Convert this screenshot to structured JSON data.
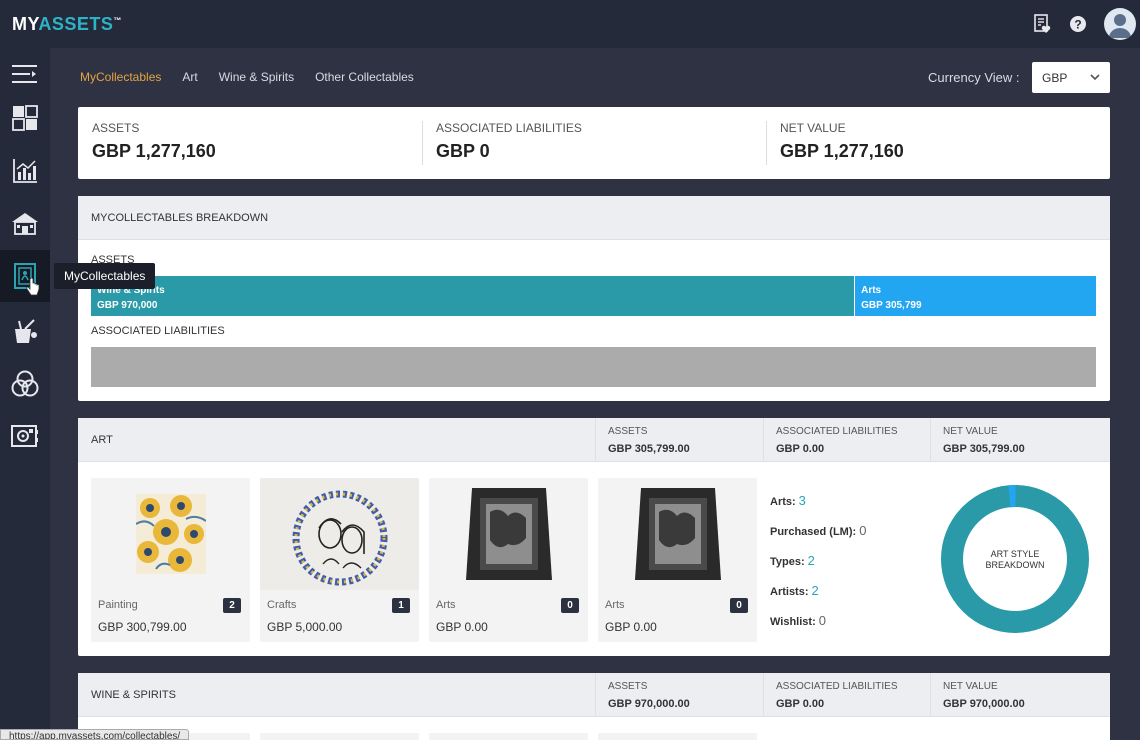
{
  "app": {
    "logo_prefix": "MY",
    "logo_main": "ASSETS",
    "logo_tm": "™"
  },
  "topbar": {
    "icons": [
      "document-heart-icon",
      "help-icon",
      "user-avatar-icon"
    ]
  },
  "sidebar": {
    "items": [
      "menu-collapse-icon",
      "dashboard-icon",
      "chart-icon",
      "property-icon",
      "collectables-icon",
      "art-supplies-icon",
      "venn-icon",
      "safe-icon"
    ],
    "active": "collectables-icon",
    "tooltip": "MyCollectables"
  },
  "subnav": {
    "tabs": [
      {
        "label": "MyCollectables",
        "active": true
      },
      {
        "label": "Art",
        "active": false
      },
      {
        "label": "Wine & Spirits",
        "active": false
      },
      {
        "label": "Other Collectables",
        "active": false
      }
    ]
  },
  "currency": {
    "label": "Currency View :",
    "value": "GBP"
  },
  "summary": {
    "assets_label": "ASSETS",
    "assets_value": "GBP 1,277,160",
    "liab_label": "ASSOCIATED LIABILITIES",
    "liab_value": "GBP 0",
    "net_label": "NET VALUE",
    "net_value": "GBP 1,277,160"
  },
  "breakdown": {
    "title": "MYCOLLECTABLES BREAKDOWN",
    "assets_label": "ASSETS",
    "segments": [
      {
        "name": "Wine & Spirits",
        "value": "GBP 970,000",
        "amount": 970000,
        "color": "#2a9aa9"
      },
      {
        "name": "Arts",
        "value": "GBP 305,799",
        "amount": 305799,
        "color": "#22a6f2"
      }
    ],
    "liab_label": "ASSOCIATED LIABILITIES"
  },
  "art": {
    "title": "ART",
    "assets_label": "ASSETS",
    "assets_value": "GBP 305,799.00",
    "liab_label": "ASSOCIATED LIABILITIES",
    "liab_value": "GBP 0.00",
    "net_label": "NET VALUE",
    "net_value": "GBP 305,799.00",
    "tiles": [
      {
        "category": "Painting",
        "value": "GBP 300,799.00",
        "count": "2"
      },
      {
        "category": "Crafts",
        "value": "GBP 5,000.00",
        "count": "1"
      },
      {
        "category": "Arts",
        "value": "GBP 0.00",
        "count": "0"
      },
      {
        "category": "Arts",
        "value": "GBP 0.00",
        "count": "0"
      }
    ],
    "stats": [
      {
        "label": "Arts:",
        "value": "3"
      },
      {
        "label": "Purchased (LM):",
        "value": "0"
      },
      {
        "label": "Types:",
        "value": "2"
      },
      {
        "label": "Artists:",
        "value": "2"
      },
      {
        "label": "Wishlist:",
        "value": "0"
      }
    ],
    "donut_label_1": "ART STYLE",
    "donut_label_2": "BREAKDOWN",
    "donut_main_color": "#2a9aa9",
    "donut_minor_color": "#22a6f2"
  },
  "wine": {
    "title": "WINE & SPIRITS",
    "assets_label": "ASSETS",
    "assets_value": "GBP 970,000.00",
    "liab_label": "ASSOCIATED LIABILITIES",
    "liab_value": "GBP 0.00",
    "net_label": "NET VALUE",
    "net_value": "GBP 970,000.00"
  },
  "status_url": "https://app.myassets.com/collectables/"
}
